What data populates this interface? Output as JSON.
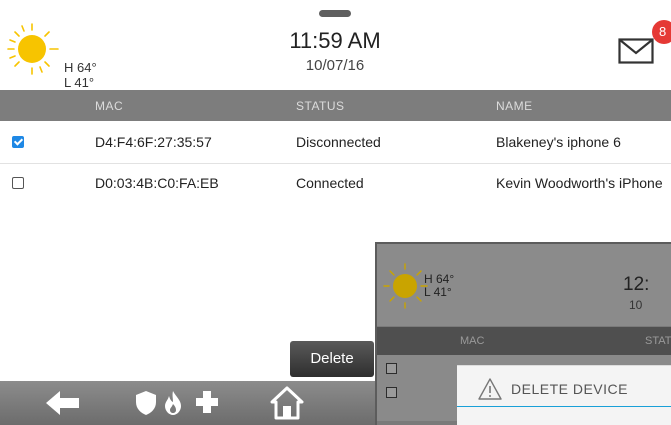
{
  "header": {
    "weather": {
      "high": "H 64°",
      "low": "L 41°",
      "icon": "sun-icon"
    },
    "time": "11:59 AM",
    "date": "10/07/16",
    "messages": {
      "icon": "envelope-icon",
      "count": "8"
    }
  },
  "table": {
    "columns": [
      "MAC",
      "STATUS",
      "NAME"
    ],
    "rows": [
      {
        "checked": true,
        "mac": "D4:F4:6F:27:35:57",
        "status": "Disconnected",
        "name": "Blakeney's iphone 6"
      },
      {
        "checked": false,
        "mac": "D0:03:4B:C0:FA:EB",
        "status": "Connected",
        "name": "Kevin Woodworth's iPhone"
      }
    ]
  },
  "actions": {
    "delete_label": "Delete"
  },
  "nav": {
    "items": [
      "back-arrow-icon",
      "shield-icon",
      "fire-icon",
      "medical-plus-icon",
      "home-icon"
    ]
  },
  "overlay": {
    "weather": {
      "high": "H 64°",
      "low": "L 41°"
    },
    "time": "12:",
    "date": "10",
    "columns": [
      "MAC",
      "STAT"
    ],
    "dialog_title": "DELETE DEVICE",
    "dialog_icon": "warning-icon"
  },
  "colors": {
    "accent": "#1e88e5",
    "badge": "#e53935",
    "sun": "#f7c400",
    "header_row": "#7d7d7d",
    "nav_bar": "#7a7a7a",
    "dialog_line": "#19a0d8"
  }
}
